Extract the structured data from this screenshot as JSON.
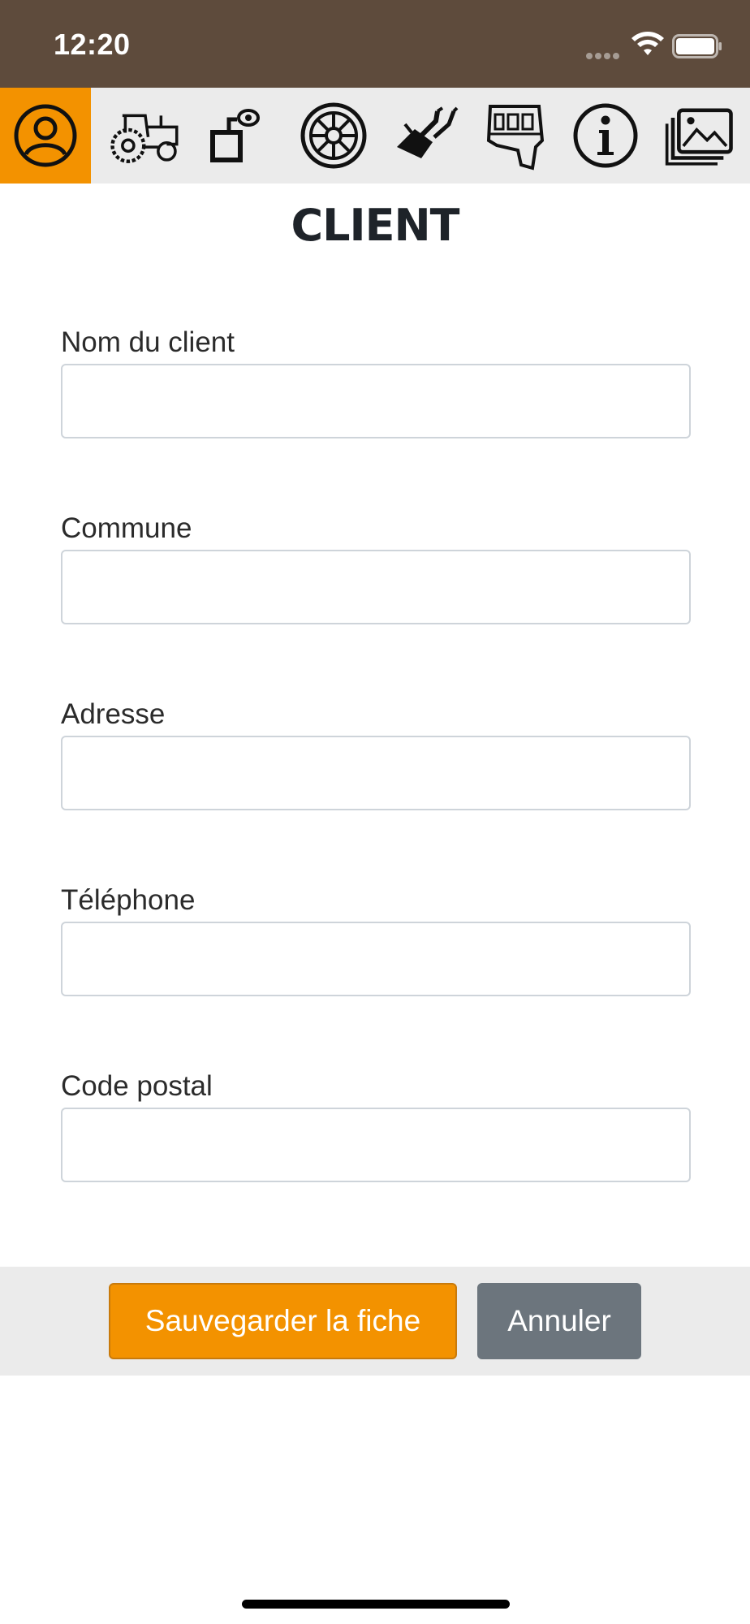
{
  "status_bar": {
    "time": "12:20"
  },
  "nav": {
    "items": [
      {
        "icon": "client-icon",
        "active": true
      },
      {
        "icon": "tractor-icon",
        "active": false
      },
      {
        "icon": "inspection-icon",
        "active": false
      },
      {
        "icon": "wheel-icon",
        "active": false
      },
      {
        "icon": "loader-icon",
        "active": false
      },
      {
        "icon": "cab-icon",
        "active": false
      },
      {
        "icon": "info-icon",
        "active": false
      },
      {
        "icon": "gallery-icon",
        "active": false
      }
    ]
  },
  "page": {
    "title": "CLIENT"
  },
  "form": {
    "name": {
      "label": "Nom du client",
      "value": "",
      "placeholder": ""
    },
    "commune": {
      "label": "Commune",
      "value": "",
      "placeholder": ""
    },
    "address": {
      "label": "Adresse",
      "value": "",
      "placeholder": ""
    },
    "phone": {
      "label": "Téléphone",
      "value": "",
      "placeholder": ""
    },
    "postal": {
      "label": "Code postal",
      "value": "",
      "placeholder": ""
    }
  },
  "actions": {
    "save_label": "Sauvegarder la fiche",
    "cancel_label": "Annuler"
  },
  "colors": {
    "status_bar": "#5e4b3c",
    "accent": "#f39200",
    "nav_bg": "#ebebeb",
    "cancel": "#6c757d"
  }
}
